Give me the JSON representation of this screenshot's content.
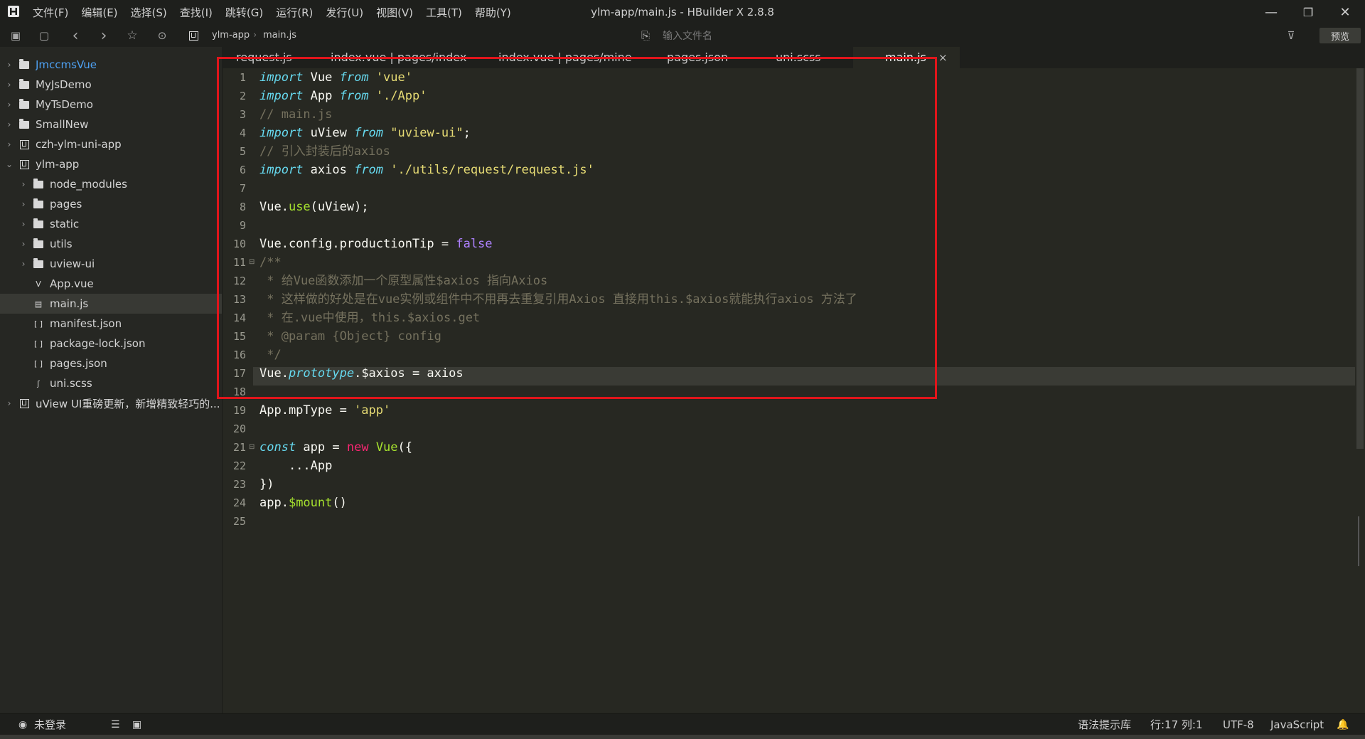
{
  "window": {
    "title": "ylm-app/main.js - HBuilder X 2.8.8",
    "menu": [
      "文件(F)",
      "编辑(E)",
      "选择(S)",
      "查找(I)",
      "跳转(G)",
      "运行(R)",
      "发行(U)",
      "视图(V)",
      "工具(T)",
      "帮助(Y)"
    ],
    "controls": {
      "minimize": "—",
      "restore": "❐",
      "close": "✕"
    }
  },
  "toolbar": {
    "breadcrumb": [
      "ylm-app",
      "main.js"
    ],
    "breadcrumb_sep": "›",
    "search_placeholder": "输入文件名",
    "preview_label": "预览"
  },
  "sidebar": {
    "items": [
      {
        "label": "JmccmsVue",
        "icon": "folder-icon",
        "chevron": "›",
        "color": "#4ea1f3"
      },
      {
        "label": "MyJsDemo",
        "icon": "folder-icon",
        "chevron": "›"
      },
      {
        "label": "MyTsDemo",
        "icon": "folder-icon",
        "chevron": "›"
      },
      {
        "label": "SmallNew",
        "icon": "folder-icon",
        "chevron": "›"
      },
      {
        "label": "czh-ylm-uni-app",
        "icon": "uni-project-icon",
        "chevron": "›"
      },
      {
        "label": "ylm-app",
        "icon": "uni-project-icon",
        "chevron": "⌄"
      },
      {
        "label": "node_modules",
        "icon": "folder-icon",
        "chevron": "›"
      },
      {
        "label": "pages",
        "icon": "folder-icon",
        "chevron": "›"
      },
      {
        "label": "static",
        "icon": "folder-icon",
        "chevron": "›"
      },
      {
        "label": "utils",
        "icon": "folder-icon",
        "chevron": "›"
      },
      {
        "label": "uview-ui",
        "icon": "folder-icon",
        "chevron": "›"
      },
      {
        "label": "App.vue",
        "icon": "vue-file-icon",
        "glyph": "V",
        "chevron": ""
      },
      {
        "label": "main.js",
        "icon": "js-file-icon",
        "glyph": "▤",
        "chevron": ""
      },
      {
        "label": "manifest.json",
        "icon": "json-file-icon",
        "glyph": "[ ]",
        "chevron": ""
      },
      {
        "label": "package-lock.json",
        "icon": "json-file-icon",
        "glyph": "[ ]",
        "chevron": ""
      },
      {
        "label": "pages.json",
        "icon": "json-file-icon",
        "glyph": "[ ]",
        "chevron": ""
      },
      {
        "label": "uni.scss",
        "icon": "scss-file-icon",
        "glyph": "ʃ",
        "chevron": ""
      },
      {
        "label": "uView UI重磅更新，新增精致轻巧的...",
        "icon": "uni-project-icon",
        "chevron": "›"
      }
    ]
  },
  "tabs": [
    {
      "label": "request.js"
    },
    {
      "label": "index.vue | pages/index"
    },
    {
      "label": "index.vue | pages/mine"
    },
    {
      "label": "pages.json"
    },
    {
      "label": "uni.scss"
    },
    {
      "label": "main.js",
      "close": "×"
    }
  ],
  "editor": {
    "line_numbers": [
      "1",
      "2",
      "3",
      "4",
      "5",
      "6",
      "7",
      "8",
      "9",
      "10",
      "11",
      "12",
      "13",
      "14",
      "15",
      "16",
      "17",
      "18",
      "19",
      "20",
      "21",
      "22",
      "23",
      "24",
      "25"
    ],
    "fold_markers": {
      "line11": "⊟",
      "line21": "⊟"
    },
    "lines": [
      [
        {
          "t": "import",
          "c": "kw-i"
        },
        {
          "t": " Vue ",
          "c": ""
        },
        {
          "t": "from",
          "c": "kw-i"
        },
        {
          "t": " ",
          "c": ""
        },
        {
          "t": "'vue'",
          "c": "str"
        }
      ],
      [
        {
          "t": "import",
          "c": "kw-i"
        },
        {
          "t": " App ",
          "c": ""
        },
        {
          "t": "from",
          "c": "kw-i"
        },
        {
          "t": " ",
          "c": ""
        },
        {
          "t": "'./App'",
          "c": "str"
        }
      ],
      [
        {
          "t": "// main.js",
          "c": "cm"
        }
      ],
      [
        {
          "t": "import",
          "c": "kw-i"
        },
        {
          "t": " uView ",
          "c": ""
        },
        {
          "t": "from",
          "c": "kw-i"
        },
        {
          "t": " ",
          "c": ""
        },
        {
          "t": "\"uview-ui\"",
          "c": "str"
        },
        {
          "t": ";",
          "c": ""
        }
      ],
      [
        {
          "t": "// 引入封装后的axios",
          "c": "cm"
        }
      ],
      [
        {
          "t": "import",
          "c": "kw-i"
        },
        {
          "t": " axios ",
          "c": ""
        },
        {
          "t": "from",
          "c": "kw-i"
        },
        {
          "t": " ",
          "c": ""
        },
        {
          "t": "'./utils/request/request.js'",
          "c": "str"
        }
      ],
      [],
      [
        {
          "t": "Vue.",
          "c": ""
        },
        {
          "t": "use",
          "c": "fn"
        },
        {
          "t": "(uView);",
          "c": ""
        }
      ],
      [],
      [
        {
          "t": "Vue.config.productionTip = ",
          "c": ""
        },
        {
          "t": "false",
          "c": "num"
        }
      ],
      [
        {
          "t": "/**",
          "c": "cm"
        }
      ],
      [
        {
          "t": " * 给Vue函数添加一个原型属性$axios 指向Axios",
          "c": "cm"
        }
      ],
      [
        {
          "t": " * 这样做的好处是在vue实例或组件中不用再去重复引用Axios 直接用this.$axios就能执行axios 方法了",
          "c": "cm"
        }
      ],
      [
        {
          "t": " * 在.vue中使用，this.$axios.get",
          "c": "cm"
        }
      ],
      [
        {
          "t": " * @param {Object} config",
          "c": "cm"
        }
      ],
      [
        {
          "t": " */",
          "c": "cm"
        }
      ],
      [
        {
          "t": "Vue.",
          "c": ""
        },
        {
          "t": "prototype",
          "c": "kw-i"
        },
        {
          "t": ".$axios = axios",
          "c": ""
        }
      ],
      [],
      [
        {
          "t": "App.mpType = ",
          "c": ""
        },
        {
          "t": "'app'",
          "c": "str"
        }
      ],
      [],
      [
        {
          "t": "const",
          "c": "kw-i"
        },
        {
          "t": " app = ",
          "c": ""
        },
        {
          "t": "new",
          "c": "kw"
        },
        {
          "t": " ",
          "c": ""
        },
        {
          "t": "Vue",
          "c": "fn"
        },
        {
          "t": "({",
          "c": ""
        }
      ],
      [
        {
          "t": "    ...App",
          "c": ""
        }
      ],
      [
        {
          "t": "})",
          "c": ""
        }
      ],
      [
        {
          "t": "app.",
          "c": ""
        },
        {
          "t": "$mount",
          "c": "fn"
        },
        {
          "t": "()",
          "c": ""
        }
      ],
      []
    ],
    "current_line": 17
  },
  "statusbar": {
    "login": "未登录",
    "syntax_lib": "语法提示库",
    "position": "行:17  列:1",
    "encoding": "UTF-8",
    "language": "JavaScript"
  },
  "colors": {
    "bg": "#272822",
    "chrome": "#1e1f1c",
    "highlight_box": "#e0151b",
    "keyword": "#66d9ef",
    "string": "#e6db74",
    "comment": "#75715e"
  }
}
